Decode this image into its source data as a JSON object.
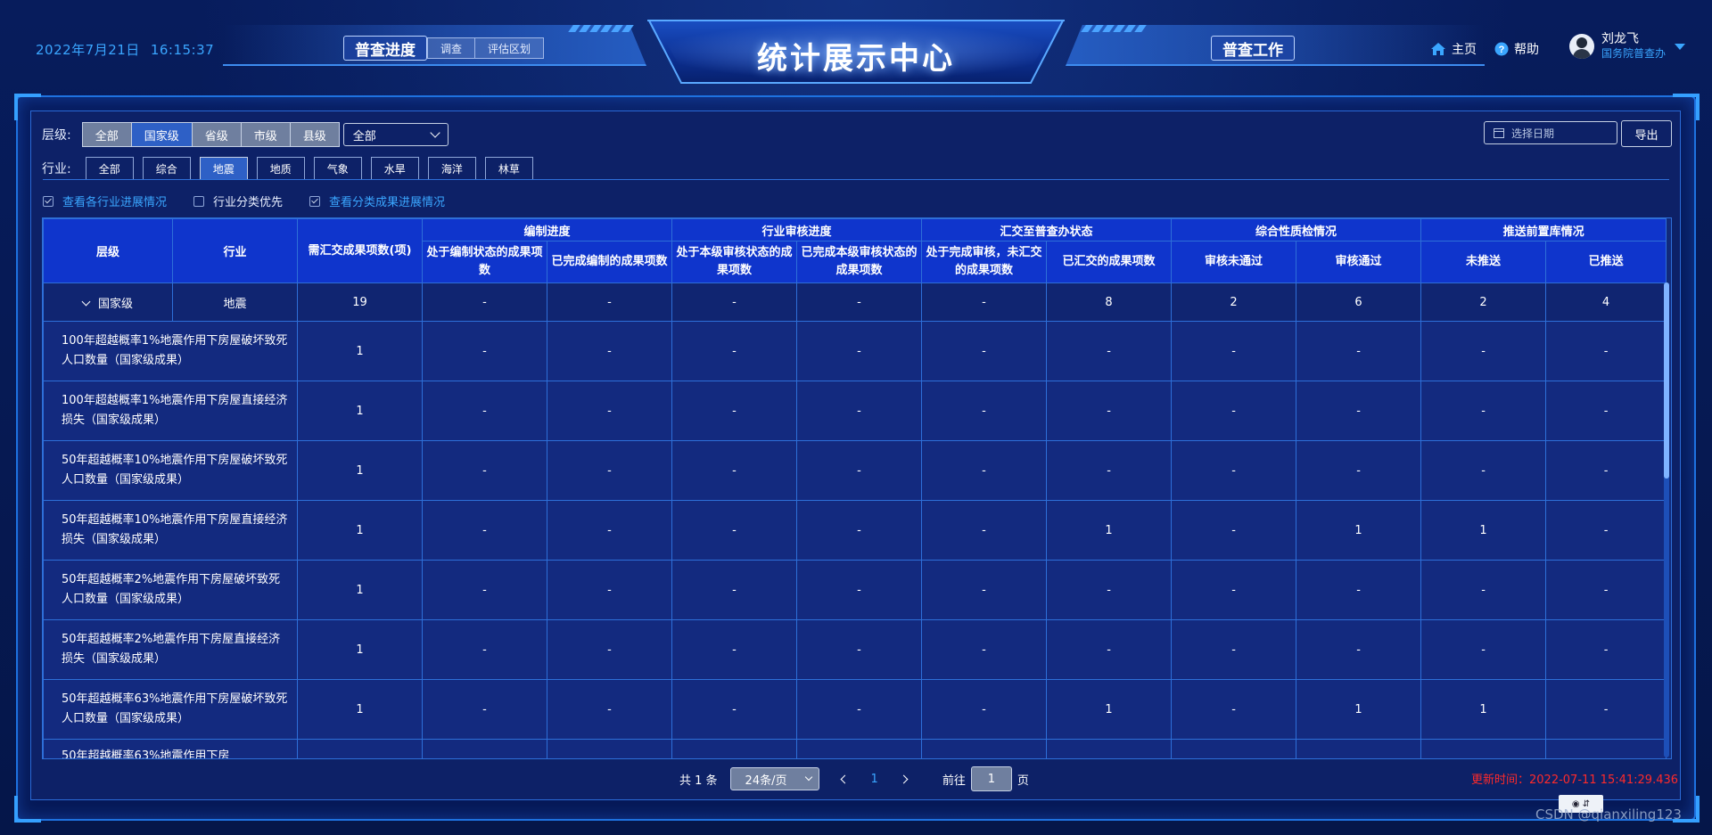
{
  "header": {
    "date": "2022年7月21日",
    "time": "16:15:37",
    "title": "统计展示中心",
    "nav_left": {
      "main": "普查进度",
      "subs": [
        "调查",
        "评估区划"
      ]
    },
    "nav_right": {
      "main": "普查工作"
    },
    "links": {
      "home": "主页",
      "help": "帮助"
    },
    "user": {
      "name": "刘龙飞",
      "org": "国务院普查办"
    }
  },
  "filters": {
    "level_label": "层级:",
    "level_options": [
      "全部",
      "国家级",
      "省级",
      "市级",
      "县级"
    ],
    "level_active": "国家级",
    "level_select_value": "全部",
    "industry_label": "行业:",
    "industry_options": [
      "全部",
      "综合",
      "地震",
      "地质",
      "气象",
      "水旱",
      "海洋",
      "林草"
    ],
    "industry_active": "地震",
    "date_placeholder": "选择日期",
    "export_label": "导出",
    "checks": [
      {
        "label": "查看各行业进展情况",
        "checked": true
      },
      {
        "label": "行业分类优先",
        "checked": false
      },
      {
        "label": "查看分类成果进展情况",
        "checked": true
      }
    ]
  },
  "table": {
    "head_row1": {
      "level": "层级",
      "industry": "行业",
      "required": "需汇交成果项数(项)",
      "groups": [
        "编制进度",
        "行业审核进度",
        "汇交至普查办状态",
        "综合性质检情况",
        "推送前置库情况"
      ]
    },
    "head_row2": [
      "处于编制状态的成果项数",
      "已完成编制的成果项数",
      "处于本级审核状态的成果项数",
      "已完成本级审核状态的成果项数",
      "处于完成审核，未汇交的成果项数",
      "已汇交的成果项数",
      "审核未通过",
      "审核通过",
      "未推送",
      "已推送"
    ],
    "group_row": {
      "level": "国家级",
      "industry": "地震",
      "cells": [
        "19",
        "-",
        "-",
        "-",
        "-",
        "-",
        "8",
        "2",
        "6",
        "2",
        "4"
      ]
    },
    "rows": [
      {
        "name": "100年超越概率1%地震作用下房屋破坏致死人口数量（国家级成果）",
        "cells": [
          "1",
          "-",
          "-",
          "-",
          "-",
          "-",
          "-",
          "-",
          "-",
          "-",
          "-"
        ]
      },
      {
        "name": "100年超越概率1%地震作用下房屋直接经济损失（国家级成果）",
        "cells": [
          "1",
          "-",
          "-",
          "-",
          "-",
          "-",
          "-",
          "-",
          "-",
          "-",
          "-"
        ]
      },
      {
        "name": "50年超越概率10%地震作用下房屋破坏致死人口数量（国家级成果）",
        "cells": [
          "1",
          "-",
          "-",
          "-",
          "-",
          "-",
          "-",
          "-",
          "-",
          "-",
          "-"
        ]
      },
      {
        "name": "50年超越概率10%地震作用下房屋直接经济损失（国家级成果）",
        "cells": [
          "1",
          "-",
          "-",
          "-",
          "-",
          "-",
          "1",
          "-",
          "1",
          "1",
          "-"
        ]
      },
      {
        "name": "50年超越概率2%地震作用下房屋破坏致死人口数量（国家级成果）",
        "cells": [
          "1",
          "-",
          "-",
          "-",
          "-",
          "-",
          "-",
          "-",
          "-",
          "-",
          "-"
        ]
      },
      {
        "name": "50年超越概率2%地震作用下房屋直接经济损失（国家级成果）",
        "cells": [
          "1",
          "-",
          "-",
          "-",
          "-",
          "-",
          "-",
          "-",
          "-",
          "-",
          "-"
        ]
      },
      {
        "name": "50年超越概率63%地震作用下房屋破坏致死人口数量（国家级成果）",
        "cells": [
          "1",
          "-",
          "-",
          "-",
          "-",
          "-",
          "1",
          "-",
          "1",
          "1",
          "-"
        ]
      },
      {
        "name": "50年超越概率63%地震作用下房",
        "cells": [
          "",
          "",
          "",
          "",
          "",
          "",
          "",
          "",
          "",
          "",
          ""
        ]
      }
    ]
  },
  "pagination": {
    "total": "共 1 条",
    "page_size": "24条/页",
    "current_page": "1",
    "goto_label": "前往",
    "goto_value": "1",
    "page_unit": "页"
  },
  "update_time": "更新时间：2022-07-11 15:41:29.436",
  "watermark": "CSDN @qianxiling123",
  "colors": {
    "accent": "#3aa6ff",
    "header_bg": "#0f35cc",
    "update_text": "#ff2a2a",
    "active_tab": "#2e60c6"
  }
}
